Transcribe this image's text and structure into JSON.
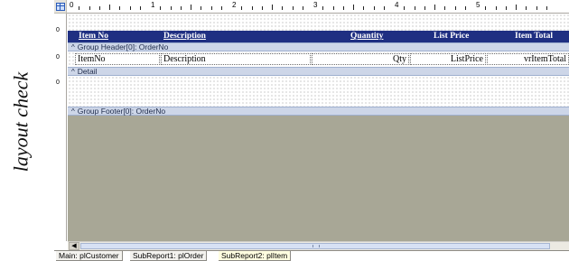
{
  "side_caption": "layout check",
  "ruler": {
    "inch_labels": [
      "0",
      "1",
      "2",
      "3",
      "4",
      "5"
    ]
  },
  "vertical_ruler_marks": [
    "0",
    "0",
    "0"
  ],
  "report": {
    "page_header": {
      "columns": [
        "Item No",
        "Description",
        "Quantity",
        "List Price",
        "Item Total"
      ]
    },
    "group_header_band": "Group Header[0]: OrderNo",
    "group_header_fields": [
      "ItemNo",
      "Description",
      "Qty",
      "ListPrice",
      "vrItemTotal"
    ],
    "detail_band": "Detail",
    "group_footer_band": "Group Footer[0]: OrderNo"
  },
  "tabs": [
    "Main: plCustomer",
    "SubReport1: plOrder",
    "SubReport2: plItem"
  ],
  "active_tab": "SubReport2: plItem",
  "colors": {
    "header_strip": "#1f2f82",
    "band_bar": "#cdd6e8",
    "canvas_background": "#a8a796",
    "active_tab": "#fffde0"
  }
}
